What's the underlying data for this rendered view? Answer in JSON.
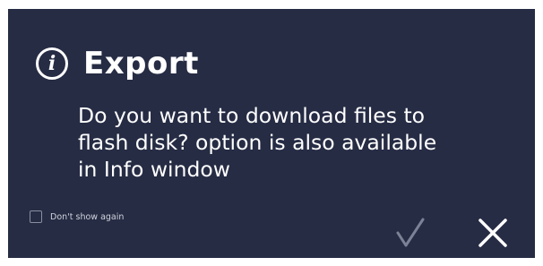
{
  "dialog": {
    "title": "Export",
    "message_lines": [
      "Do you want to download files to",
      "flash disk? option is also available",
      "in Info window"
    ],
    "dont_show_again_label": "Don't show again",
    "dont_show_again_checked": false,
    "icons": {
      "header": "info-icon",
      "confirm": "check-icon",
      "close": "close-icon"
    }
  },
  "colors": {
    "dialog_background": "#262c44",
    "text": "#ffffff",
    "confirm_disabled": "#7c8296"
  }
}
